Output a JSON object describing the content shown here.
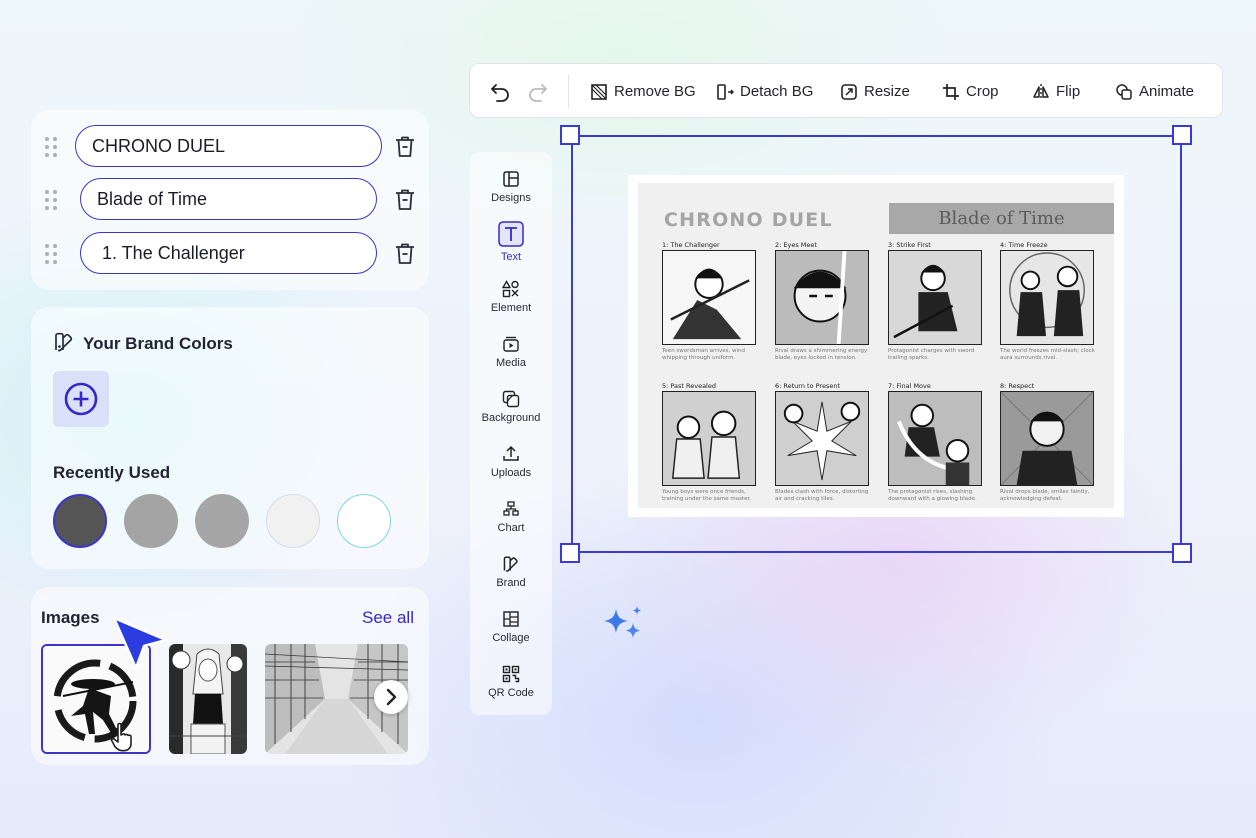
{
  "text_layers": [
    "CHRONO DUEL",
    "Blade of Time",
    "1. The Challenger"
  ],
  "brand": {
    "title": "Your Brand Colors",
    "recent_title": "Recently Used",
    "recent_colors": [
      "#555555",
      "#a4a4a4",
      "#a6a6a6",
      "#f1f1f1",
      "#ffffff"
    ]
  },
  "images": {
    "title": "Images",
    "see_all": "See all"
  },
  "toolbar": {
    "remove_bg": "Remove BG",
    "detach_bg": "Detach BG",
    "resize": "Resize",
    "crop": "Crop",
    "flip": "Flip",
    "animate": "Animate"
  },
  "rail": [
    "Designs",
    "Text",
    "Element",
    "Media",
    "Background",
    "Uploads",
    "Chart",
    "Brand",
    "Collage",
    "QR Code"
  ],
  "rail_active": "Text",
  "comic": {
    "title": "CHRONO DUEL",
    "subtitle": "Blade of Time",
    "panels": [
      {
        "cap": "1: The Challenger",
        "desc": "Teen swordsman arrives, wind whipping through uniform."
      },
      {
        "cap": "2: Eyes Meet",
        "desc": "Rival draws a shimmering energy blade, eyes locked in tension."
      },
      {
        "cap": "3: Strike First",
        "desc": "Protagonist charges with sword trailing sparks."
      },
      {
        "cap": "4: Time Freeze",
        "desc": "The world freezes mid-slash; clock aura surrounds rival."
      },
      {
        "cap": "5: Past Revealed",
        "desc": "Young boys were once friends, training under the same master."
      },
      {
        "cap": "6: Return to Present",
        "desc": "Blades clash with force, distorting air and cracking tiles."
      },
      {
        "cap": "7: Final Move",
        "desc": "The protagonist rises, slashing downward with a glowing blade."
      },
      {
        "cap": "8: Respect",
        "desc": "Rival drops blade, smiles faintly, acknowledging defeat."
      }
    ]
  },
  "colors": {
    "accent": "#3b35c9",
    "selection": "#3a3ad4"
  }
}
